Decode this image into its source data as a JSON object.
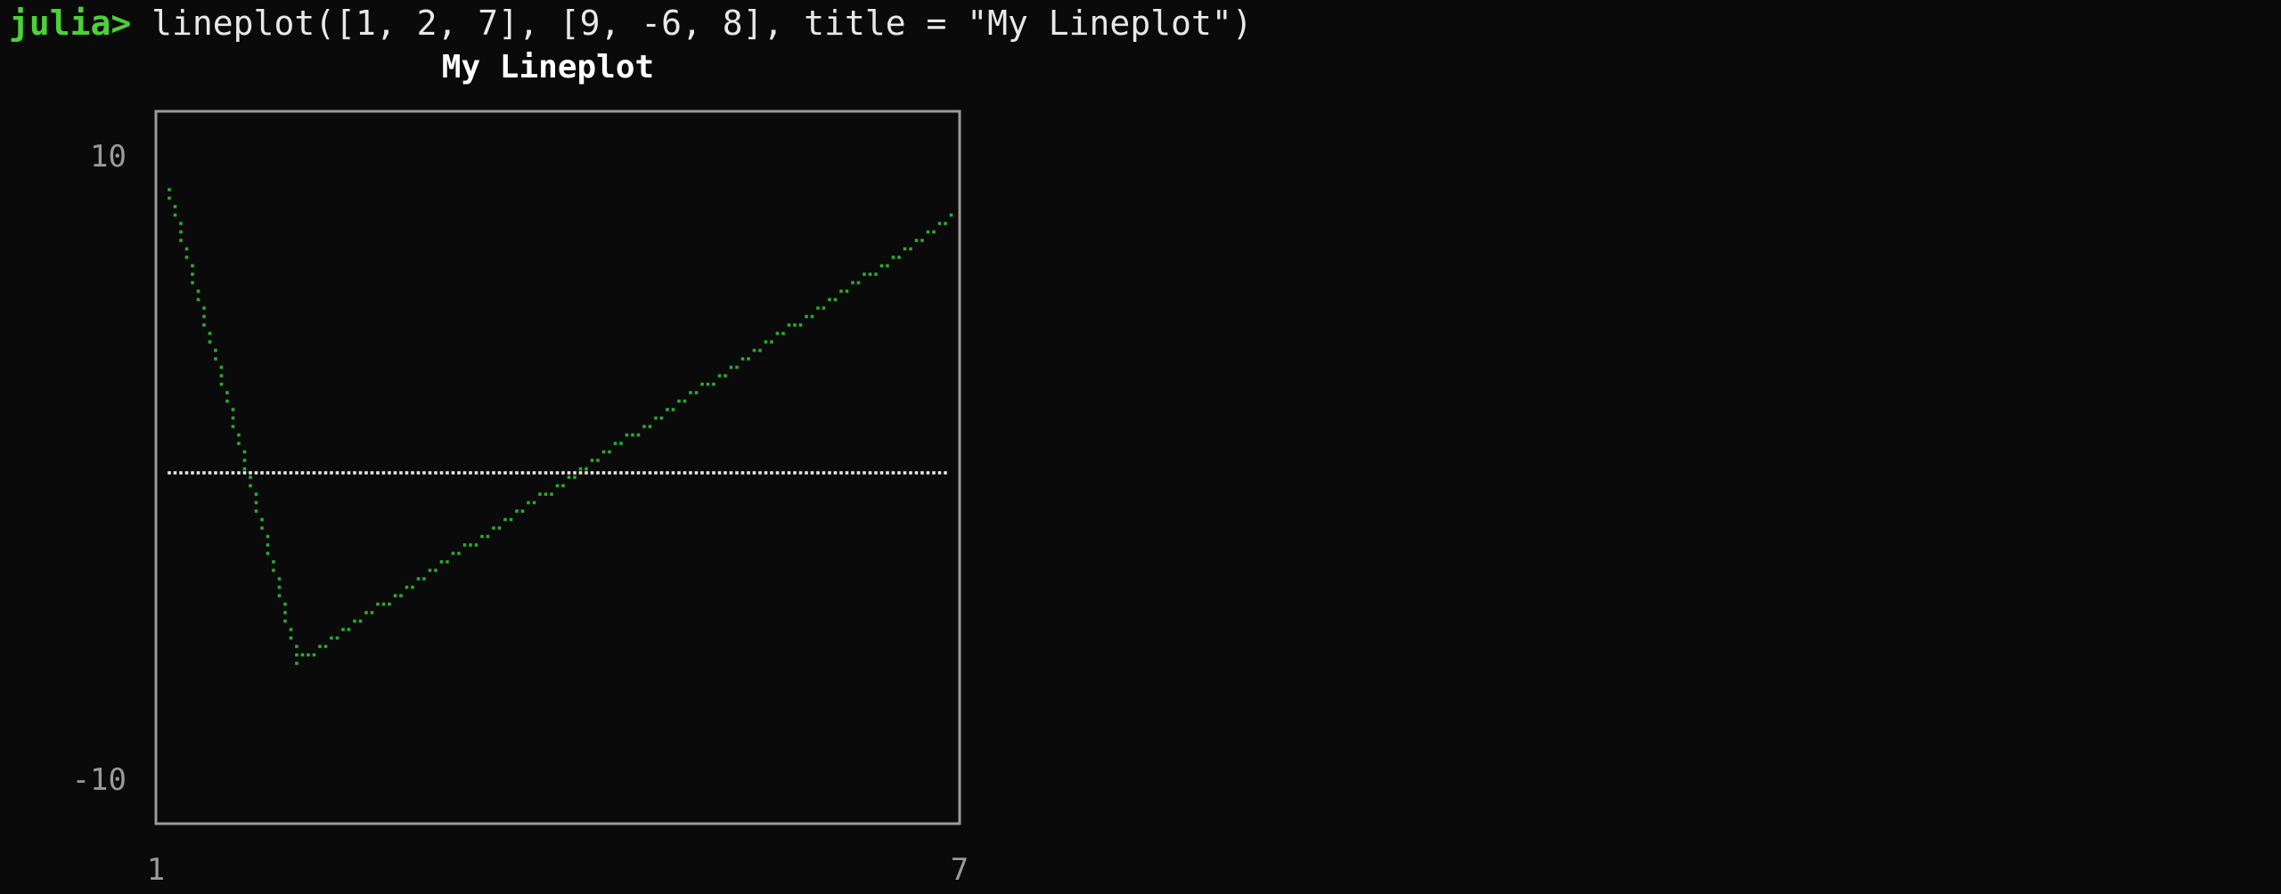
{
  "terminal": {
    "prompt": "julia>",
    "command": "lineplot([1, 2, 7], [9, -6, 8], title = \"My Lineplot\")"
  },
  "colors": {
    "background": "#0a0a0a",
    "prompt": "#4cd137",
    "series": "#2ea82e",
    "zero_line": "#e6e6e6",
    "frame": "#9a9a9a",
    "tick_label": "#9a9a9a",
    "title": "#ffffff"
  },
  "chart_data": {
    "type": "line",
    "title": "My Lineplot",
    "xlabel": "",
    "ylabel": "",
    "xlim": [
      1,
      7
    ],
    "ylim": [
      -10,
      10
    ],
    "x_tick_labels": [
      "1",
      "7"
    ],
    "y_tick_labels": [
      "10",
      "-10"
    ],
    "series": [
      {
        "x": [
          1,
          2,
          7
        ],
        "y": [
          9,
          -6,
          8
        ]
      }
    ],
    "reference_lines": [
      {
        "axis": "y",
        "value": 0,
        "style": "dotted"
      }
    ],
    "grid": false,
    "legend": "none"
  }
}
